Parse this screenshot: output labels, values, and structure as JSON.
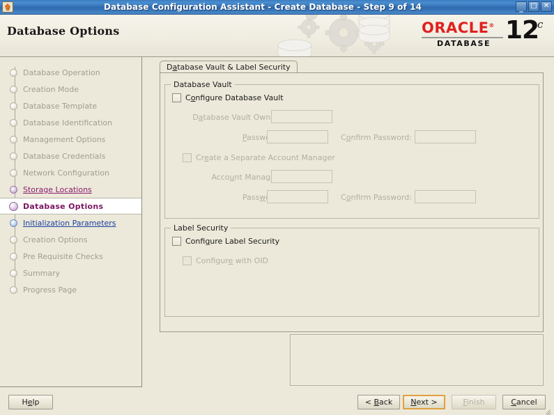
{
  "window": {
    "title": "Database Configuration Assistant - Create Database - Step 9 of 14",
    "app_icon": "oracle-dbca-icon",
    "controls": {
      "minimize": "_",
      "maximize": "□",
      "close": "✕"
    }
  },
  "banner": {
    "title": "Database Options",
    "logo": {
      "brand": "ORACLE",
      "registered": "®",
      "product": "DATABASE",
      "version": "12",
      "suffix": "c"
    },
    "artwork": "gears-and-database-cylinders"
  },
  "sidebar": {
    "items": [
      {
        "label": "Database Operation",
        "state": "done"
      },
      {
        "label": "Creation Mode",
        "state": "done"
      },
      {
        "label": "Database Template",
        "state": "done"
      },
      {
        "label": "Database Identification",
        "state": "done"
      },
      {
        "label": "Management Options",
        "state": "done"
      },
      {
        "label": "Database Credentials",
        "state": "done"
      },
      {
        "label": "Network Configuration",
        "state": "done"
      },
      {
        "label": "Storage Locations",
        "state": "visited"
      },
      {
        "label": "Database Options",
        "state": "current"
      },
      {
        "label": "Initialization Parameters",
        "state": "next"
      },
      {
        "label": "Creation Options",
        "state": "done"
      },
      {
        "label": "Pre Requisite Checks",
        "state": "done"
      },
      {
        "label": "Summary",
        "state": "done"
      },
      {
        "label": "Progress Page",
        "state": "done"
      }
    ]
  },
  "main": {
    "tab": {
      "label_pre": "D",
      "label_mnemonic": "a",
      "label_post": "tabase Vault & Label Security",
      "full_label": "Database Vault & Label Security"
    },
    "database_vault": {
      "group_title": "Database Vault",
      "configure": {
        "pre": "C",
        "mnemonic": "o",
        "post": "nfigure Database Vault",
        "full": "Configure Database Vault",
        "checked": false,
        "enabled": true
      },
      "owner": {
        "pre": "D",
        "mnemonic": "a",
        "post": "tabase Vault Owner:",
        "full": "Database Vault Owner:",
        "value": "",
        "enabled": false
      },
      "password": {
        "pre": "",
        "mnemonic": "P",
        "post": "assword:",
        "full": "Password:",
        "value": "",
        "enabled": false
      },
      "confirm_password": {
        "pre": "C",
        "mnemonic": "o",
        "post": "nfirm Password:",
        "full": "Confirm Password:",
        "value": "",
        "enabled": false
      },
      "separate_account_manager": {
        "pre": "Cr",
        "mnemonic": "e",
        "post": "ate a Separate Account Manager",
        "full": "Create a Separate Account Manager",
        "checked": false,
        "enabled": false
      },
      "account_manager": {
        "pre": "Acco",
        "mnemonic": "u",
        "post": "nt Manager:",
        "full": "Account Manager:",
        "value": "",
        "enabled": false
      },
      "am_password": {
        "pre": "Pass",
        "mnemonic": "w",
        "post": "ord:",
        "full": "Password:",
        "value": "",
        "enabled": false
      },
      "am_confirm_password": {
        "pre": "C",
        "mnemonic": "o",
        "post": "nfirm Password:",
        "full": "Confirm Password:",
        "value": "",
        "enabled": false
      }
    },
    "label_security": {
      "group_title": "Label Security",
      "configure": {
        "pre": "Confi",
        "mnemonic": "g",
        "post": "ure Label Security",
        "full": "Configure Label Security",
        "checked": false,
        "enabled": true
      },
      "configure_with_oid": {
        "pre": "Configur",
        "mnemonic": "e",
        "post": " with OID",
        "full": "Configure with OID",
        "checked": false,
        "enabled": false
      }
    },
    "message_panel": {
      "text": ""
    }
  },
  "buttons": {
    "help": {
      "pre": "H",
      "mnemonic": "e",
      "post": "lp",
      "full": "Help",
      "enabled": true,
      "focused": false
    },
    "back": {
      "pre": "< ",
      "mnemonic": "B",
      "post": "ack",
      "full": "< Back",
      "enabled": true,
      "focused": false
    },
    "next": {
      "pre": "",
      "mnemonic": "N",
      "post": "ext >",
      "full": "Next >",
      "enabled": true,
      "focused": true
    },
    "finish": {
      "pre": "",
      "mnemonic": "F",
      "post": "inish",
      "full": "Finish",
      "enabled": false,
      "focused": false
    },
    "cancel": {
      "pre": "",
      "mnemonic": "C",
      "post": "ancel",
      "full": "Cancel",
      "enabled": true,
      "focused": false
    }
  },
  "colors": {
    "titlebar_blue": "#3b7bbf",
    "panel_bg": "#ece9da",
    "oracle_red": "#e02020",
    "current_step_text": "#7b1560",
    "visited_link": "#8b1a6b",
    "next_link": "#1b3fa0",
    "disabled_text": "#b2afa2",
    "focus_border": "#e0a040"
  }
}
